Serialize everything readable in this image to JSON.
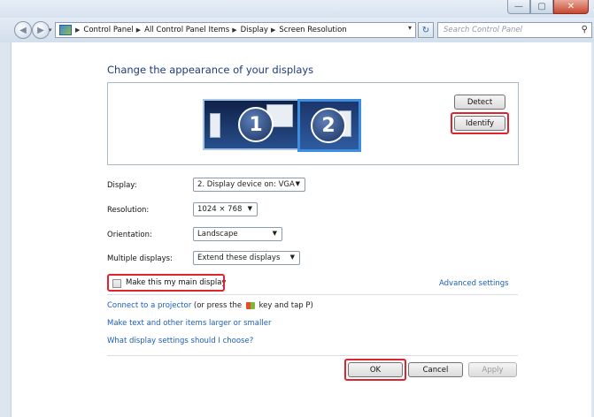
{
  "window": {
    "controls": {
      "minimize": "—",
      "maximize": "▢",
      "close": "✕"
    }
  },
  "address": {
    "breadcrumb": [
      "Control Panel",
      "All Control Panel Items",
      "Display",
      "Screen Resolution"
    ],
    "search_placeholder": "Search Control Panel"
  },
  "main": {
    "heading": "Change the appearance of your displays",
    "detect_label": "Detect",
    "identify_label": "Identify",
    "monitors": [
      {
        "number": "1"
      },
      {
        "number": "2"
      }
    ],
    "fields": {
      "display_label": "Display:",
      "display_value": "2. Display device on: VGA",
      "resolution_label": "Resolution:",
      "resolution_value": "1024 × 768",
      "orientation_label": "Orientation:",
      "orientation_value": "Landscape",
      "multiple_label": "Multiple displays:",
      "multiple_value": "Extend these displays"
    },
    "main_display_label": "Make this my main display",
    "advanced_settings": "Advanced settings",
    "projector_link": "Connect to a projector",
    "projector_tail_1": "(or press the",
    "projector_tail_2": "key and tap P)",
    "larger_link": "Make text and other items larger or smaller",
    "choose_link": "What display settings should I choose?"
  },
  "footer": {
    "ok_label": "OK",
    "cancel_label": "Cancel",
    "apply_label": "Apply"
  },
  "colors": {
    "heading": "#1e3c7a",
    "link": "#1a5dbf",
    "highlight": "#e0242e",
    "selected_monitor": "#3d8ee0"
  }
}
